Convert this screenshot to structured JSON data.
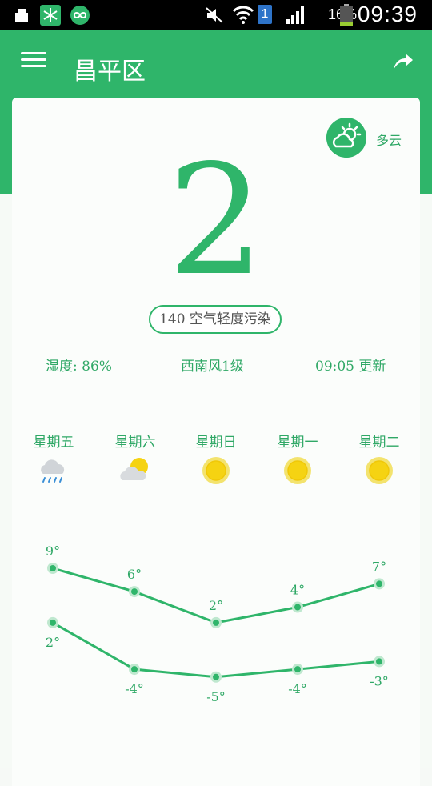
{
  "status_bar": {
    "battery_percent": "16%",
    "time": "09:39",
    "sim_label": "1"
  },
  "header": {
    "city": "昌平区"
  },
  "current": {
    "condition": "多云",
    "aqi_value": "2",
    "aqi_badge": "140 空气轻度污染",
    "humidity": "湿度: 86%",
    "wind": "西南风1级",
    "updated": "09:05 更新"
  },
  "forecast": [
    {
      "day": "星期五",
      "icon": "rain-cloud-icon",
      "high": 9,
      "low": 2,
      "high_label": "9°",
      "low_label": "2°"
    },
    {
      "day": "星期六",
      "icon": "partly-sunny-icon",
      "high": 6,
      "low": -4,
      "high_label": "6°",
      "low_label": "-4°"
    },
    {
      "day": "星期日",
      "icon": "sun-icon",
      "high": 2,
      "low": -5,
      "high_label": "2°",
      "low_label": "-5°"
    },
    {
      "day": "星期一",
      "icon": "sun-icon",
      "high": 4,
      "low": -4,
      "high_label": "4°",
      "low_label": "-4°"
    },
    {
      "day": "星期二",
      "icon": "sun-icon",
      "high": 7,
      "low": -3,
      "high_label": "7°",
      "low_label": "-3°"
    }
  ],
  "chart_data": {
    "type": "line",
    "categories": [
      "星期五",
      "星期六",
      "星期日",
      "星期一",
      "星期二"
    ],
    "series": [
      {
        "values": [
          9,
          6,
          2,
          4,
          7
        ]
      },
      {
        "values": [
          2,
          -4,
          -5,
          -4,
          -3
        ]
      }
    ],
    "ylim": [
      -5,
      9
    ]
  },
  "colors": {
    "accent": "#2fb56a",
    "text_green": "#2fa866",
    "sun": "#f5d312"
  }
}
